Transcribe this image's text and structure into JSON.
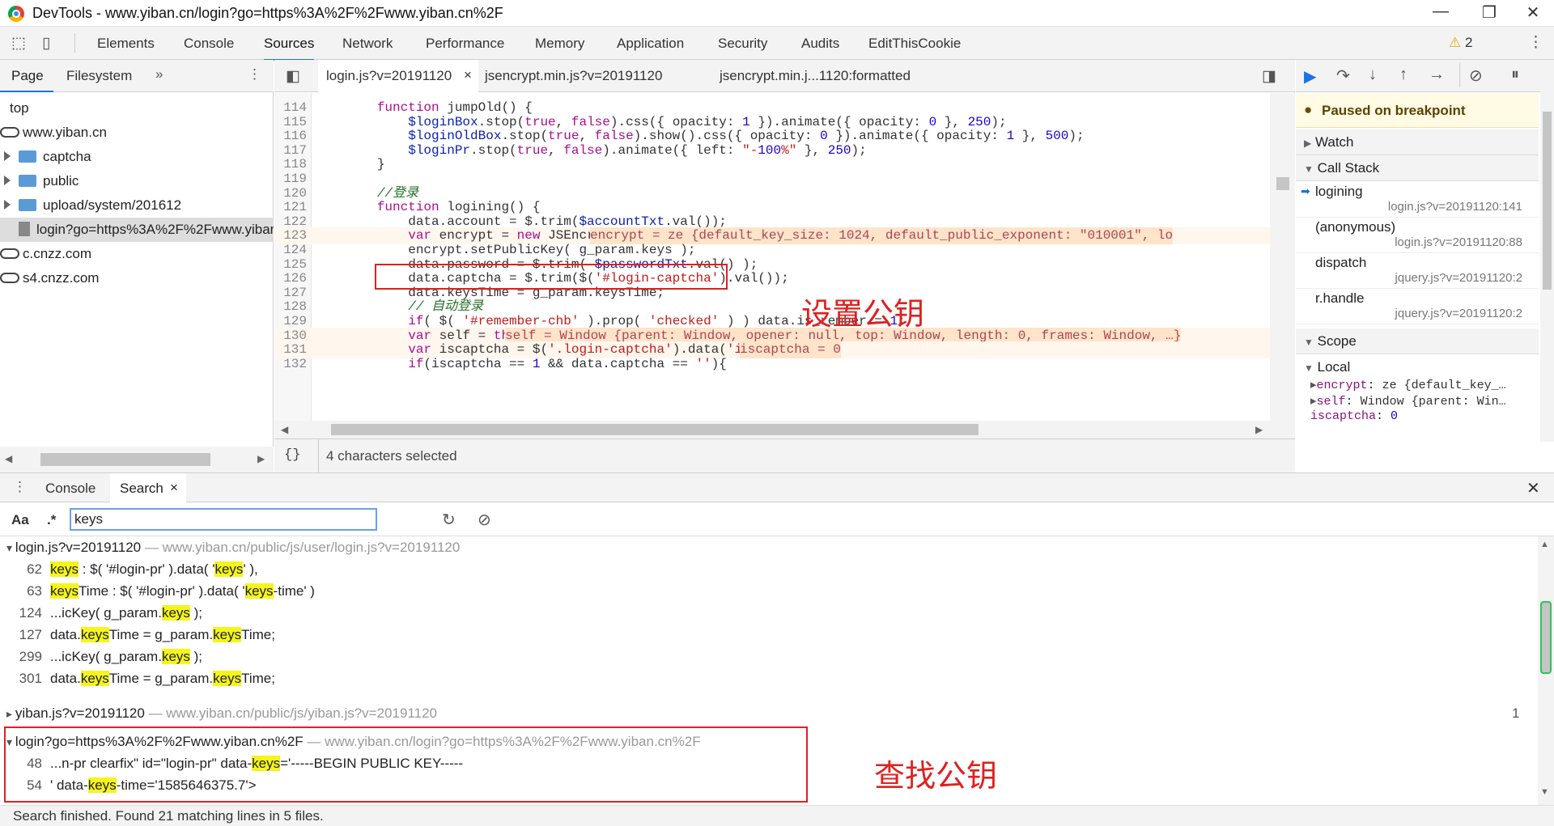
{
  "window": {
    "title": "DevTools - www.yiban.cn/login?go=https%3A%2F%2Fwww.yiban.cn%2F"
  },
  "toolbar": {
    "tabs": [
      "Elements",
      "Console",
      "Sources",
      "Network",
      "Performance",
      "Memory",
      "Application",
      "Security",
      "Audits",
      "EditThisCookie"
    ],
    "active": "Sources",
    "warning_count": "2"
  },
  "navigator": {
    "tabs": [
      "Page",
      "Filesystem"
    ],
    "tree": [
      {
        "label": "top",
        "type": "frame"
      },
      {
        "label": "www.yiban.cn",
        "type": "domain"
      },
      {
        "label": "captcha",
        "type": "folder"
      },
      {
        "label": "public",
        "type": "folder"
      },
      {
        "label": "upload/system/201612",
        "type": "folder"
      },
      {
        "label": "login?go=https%3A%2F%2Fwww.yiban",
        "type": "file"
      },
      {
        "label": "c.cnzz.com",
        "type": "domain"
      },
      {
        "label": "s4.cnzz.com",
        "type": "domain"
      }
    ]
  },
  "editor": {
    "tabs": [
      "login.js?v=20191120",
      "jsencrypt.min.js?v=20191120",
      "jsencrypt.min.j...1120:formatted"
    ],
    "lines": [
      {
        "n": "114",
        "t": "        function jumpOld() {"
      },
      {
        "n": "115",
        "t": "            $loginBox.stop(true, false).css({ opacity: 1 }).animate({ opacity: 0 }, 250);"
      },
      {
        "n": "116",
        "t": "            $loginOldBox.stop(true, false).show().css({ opacity: 0 }).animate({ opacity: 1 }, 500);"
      },
      {
        "n": "117",
        "t": "            $loginPr.stop(true, false).animate({ left: \"-100%\" }, 250);"
      },
      {
        "n": "118",
        "t": "        }"
      },
      {
        "n": "119",
        "t": ""
      },
      {
        "n": "120",
        "t": "        //登录"
      },
      {
        "n": "121",
        "t": "        function logining() {"
      },
      {
        "n": "122",
        "t": "            data.account = $.trim($accountTxt.val());"
      },
      {
        "n": "123",
        "t": "            var encrypt = new JSEncrypt();"
      },
      {
        "n": "124",
        "t": "            encrypt.setPublicKey( g_param.keys );"
      },
      {
        "n": "125",
        "t": "            data.password = $.trim( $passwordTxt.val() );"
      },
      {
        "n": "126",
        "t": "            data.captcha = $.trim($('#login-captcha').val());"
      },
      {
        "n": "127",
        "t": "            data.keysTime = g_param.keysTime;"
      },
      {
        "n": "128",
        "t": "            // 自动登录"
      },
      {
        "n": "129",
        "t": "            if( $( '#remember-chb' ).prop( 'checked' ) ) data.is_rember = 1;"
      },
      {
        "n": "130",
        "t": "            var self = this;"
      },
      {
        "n": "131",
        "t": "            var iscaptcha = $('.login-captcha').data('iscaptcha');"
      },
      {
        "n": "132",
        "t": "            if(iscaptcha == 1 && data.captcha == ''){"
      }
    ],
    "inline_values": {
      "123": "encrypt = ze {default_key_size: 1024, default_public_exponent: \"010001\", lo",
      "130": "self = Window {parent: Window, opener: null, top: Window, length: 0, frames: Window, …}",
      "131": "iscaptcha = 0"
    },
    "status": "4 characters selected"
  },
  "debugger": {
    "paused": "Paused on breakpoint",
    "sections": {
      "watch": "Watch",
      "callstack": "Call Stack",
      "scope": "Scope",
      "local": "Local"
    },
    "callstack": [
      {
        "fn": "logining",
        "loc": "login.js?v=20191120:141"
      },
      {
        "fn": "(anonymous)",
        "loc": "login.js?v=20191120:88"
      },
      {
        "fn": "dispatch",
        "loc": "jquery.js?v=20191120:2"
      },
      {
        "fn": "r.handle",
        "loc": "jquery.js?v=20191120:2"
      }
    ],
    "scope": [
      {
        "k": "encrypt",
        "v": "ze {default_key_…"
      },
      {
        "k": "self",
        "v": "Window {parent: Win…"
      },
      {
        "k": "iscaptcha",
        "v": "0"
      }
    ]
  },
  "drawer": {
    "tabs": [
      "Console",
      "Search"
    ],
    "search": {
      "aa": "Aa",
      "regex": ".*",
      "query": "keys"
    },
    "files": [
      {
        "name": "login.js?v=20191120",
        "url": "www.yiban.cn/public/js/user/login.js?v=20191120",
        "matches": [
          {
            "n": "62",
            "parts": [
              [
                "keys",
                1
              ],
              [
                " : $( '#login-pr' ).data( '",
                0
              ],
              [
                "keys",
                1
              ],
              [
                "' ),",
                0
              ]
            ]
          },
          {
            "n": "63",
            "parts": [
              [
                "keys",
                1
              ],
              [
                "Time : $( '#login-pr' ).data( '",
                0
              ],
              [
                "keys",
                1
              ],
              [
                "-time' )",
                0
              ]
            ]
          },
          {
            "n": "124",
            "parts": [
              [
                "...icKey( g_param.",
                0
              ],
              [
                "keys",
                1
              ],
              [
                " );",
                0
              ]
            ]
          },
          {
            "n": "127",
            "parts": [
              [
                "data.",
                0
              ],
              [
                "keys",
                1
              ],
              [
                "Time = g_param.",
                0
              ],
              [
                "keys",
                1
              ],
              [
                "Time;",
                0
              ]
            ]
          },
          {
            "n": "299",
            "parts": [
              [
                "...icKey( g_param.",
                0
              ],
              [
                "keys",
                1
              ],
              [
                " );",
                0
              ]
            ]
          },
          {
            "n": "301",
            "parts": [
              [
                "data.",
                0
              ],
              [
                "keys",
                1
              ],
              [
                "Time = g_param.",
                0
              ],
              [
                "keys",
                1
              ],
              [
                "Time;",
                0
              ]
            ]
          }
        ]
      },
      {
        "name": "yiban.js?v=20191120",
        "url": "www.yiban.cn/public/js/yiban.js?v=20191120",
        "count": "1"
      },
      {
        "name": "login?go=https%3A%2F%2Fwww.yiban.cn%2F",
        "url": "www.yiban.cn/login?go=https%3A%2F%2Fwww.yiban.cn%2F",
        "matches": [
          {
            "n": "48",
            "parts": [
              [
                "...n-pr clearfix\" id=\"login-pr\" data-",
                0
              ],
              [
                "keys",
                1
              ],
              [
                "='-----BEGIN PUBLIC KEY-----",
                0
              ]
            ]
          },
          {
            "n": "54",
            "parts": [
              [
                "' data-",
                0
              ],
              [
                "keys",
                1
              ],
              [
                "-time='1585646375.7'>",
                0
              ]
            ]
          }
        ]
      }
    ],
    "status": "Search finished.  Found 21 matching lines in 5 files."
  },
  "annotations": {
    "set_key": "设置公钥",
    "find_key": "查找公钥"
  },
  "colors": {
    "accent": "#1a73e8",
    "annotation": "#e02020",
    "highlight": "#f5f51c"
  }
}
